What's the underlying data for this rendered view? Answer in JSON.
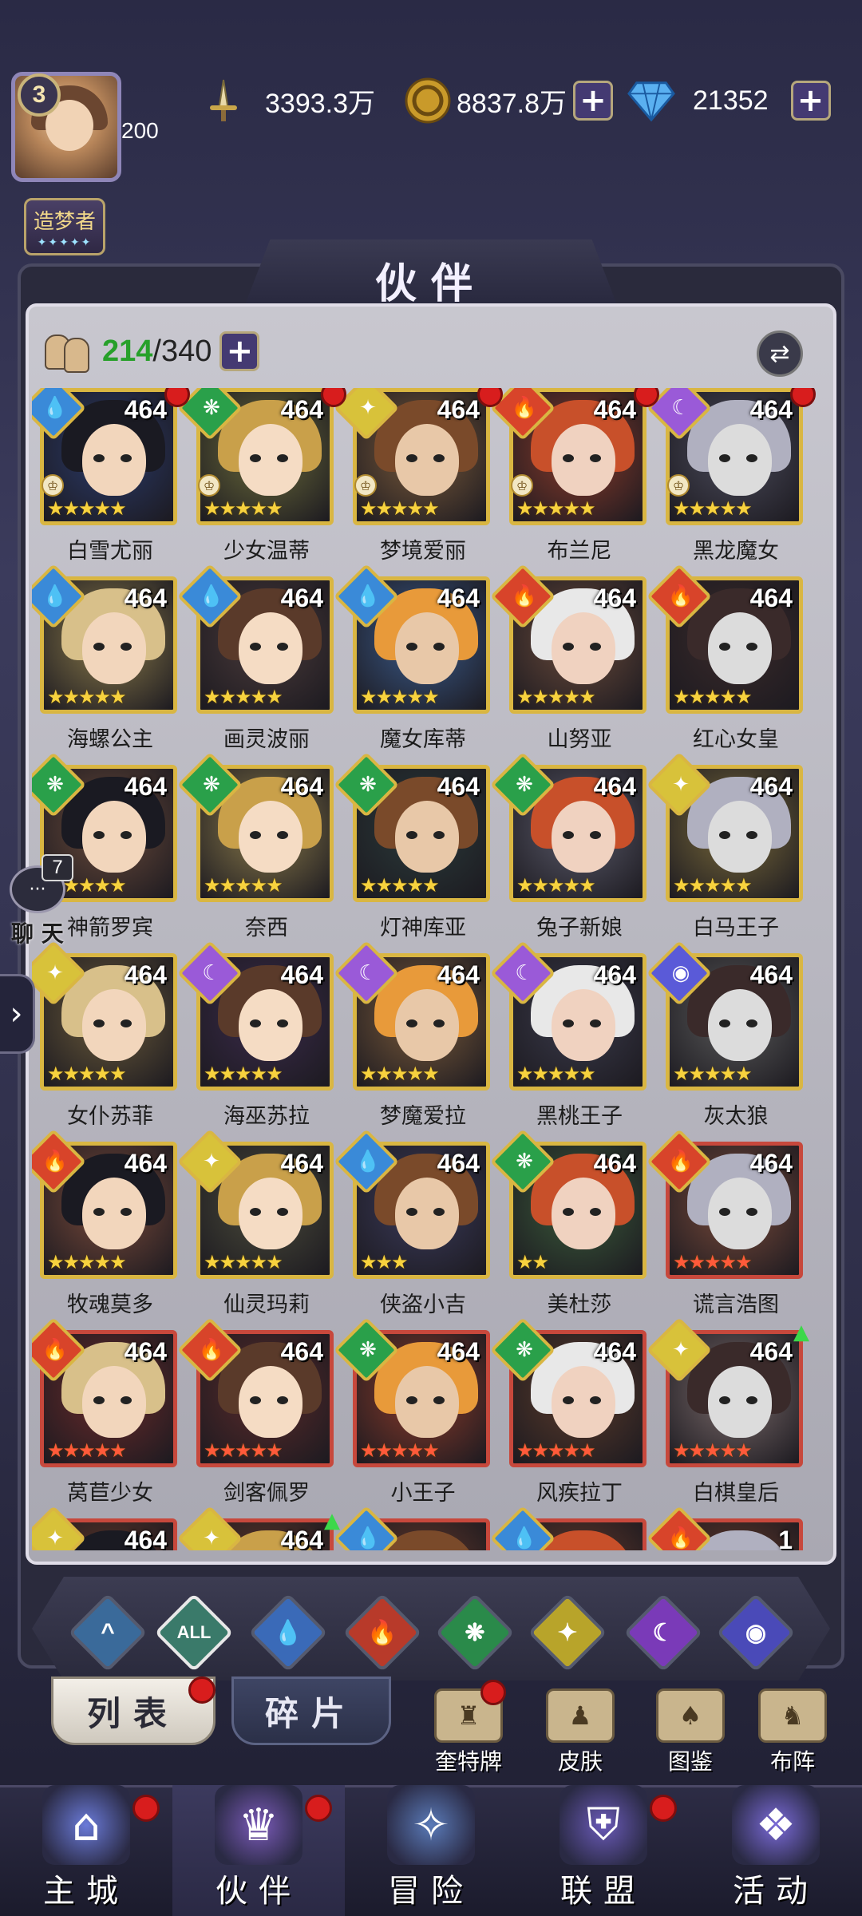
{
  "player": {
    "level": "3",
    "exp": "200",
    "title": "造梦者",
    "title_stars": "✦✦✦✦✦"
  },
  "resources": {
    "power": {
      "value": "3393.3万",
      "icon": "sword-icon"
    },
    "gold": {
      "value": "8837.8万",
      "icon": "coin-icon"
    },
    "diamond": {
      "value": "21352",
      "icon": "diamond-icon"
    },
    "plus": "+"
  },
  "page": {
    "title": "伙伴"
  },
  "roster": {
    "current": "214",
    "separator": "/",
    "max": "340",
    "plus": "+"
  },
  "heroes": [
    {
      "name": "白雪尤丽",
      "level": "464",
      "element": "water",
      "stars": "★★★★★",
      "star_color": "gold",
      "frame": "gold",
      "rank_icon": true,
      "red_dot": true,
      "up_arrow": false,
      "bg": "#2a3a6a"
    },
    {
      "name": "少女温蒂",
      "level": "464",
      "element": "wind",
      "stars": "★★★★★",
      "star_color": "gold",
      "frame": "gold",
      "rank_icon": true,
      "red_dot": true,
      "up_arrow": false,
      "bg": "#6a6a3a"
    },
    {
      "name": "梦境爱丽",
      "level": "464",
      "element": "light",
      "stars": "★★★★★",
      "star_color": "gold",
      "frame": "gold",
      "rank_icon": true,
      "red_dot": true,
      "up_arrow": false,
      "bg": "#7a5a3a"
    },
    {
      "name": "布兰尼",
      "level": "464",
      "element": "fire",
      "stars": "★★★★★",
      "star_color": "gold",
      "frame": "gold",
      "rank_icon": true,
      "red_dot": true,
      "up_arrow": false,
      "bg": "#8a3a2a"
    },
    {
      "name": "黑龙魔女",
      "level": "464",
      "element": "dark",
      "stars": "★★★★★",
      "star_color": "gold",
      "frame": "gold",
      "rank_icon": true,
      "red_dot": true,
      "up_arrow": false,
      "bg": "#4a4a5a"
    },
    {
      "name": "海螺公主",
      "level": "464",
      "element": "water",
      "stars": "★★★★★",
      "star_color": "gold",
      "frame": "gold",
      "rank_icon": false,
      "red_dot": false,
      "up_arrow": false,
      "bg": "#8a7a4a"
    },
    {
      "name": "画灵波丽",
      "level": "464",
      "element": "water",
      "stars": "★★★★★",
      "star_color": "gold",
      "frame": "gold",
      "rank_icon": false,
      "red_dot": false,
      "up_arrow": false,
      "bg": "#4a3a3a"
    },
    {
      "name": "魔女库蒂",
      "level": "464",
      "element": "water",
      "stars": "★★★★★",
      "star_color": "gold",
      "frame": "gold",
      "rank_icon": false,
      "red_dot": false,
      "up_arrow": false,
      "bg": "#3a5a8a"
    },
    {
      "name": "山努亚",
      "level": "464",
      "element": "fire",
      "stars": "★★★★★",
      "star_color": "gold",
      "frame": "gold",
      "rank_icon": false,
      "red_dot": false,
      "up_arrow": false,
      "bg": "#6a4a3a"
    },
    {
      "name": "红心女皇",
      "level": "464",
      "element": "fire",
      "stars": "★★★★★",
      "star_color": "gold",
      "frame": "gold",
      "rank_icon": false,
      "red_dot": false,
      "up_arrow": false,
      "bg": "#3a2a2a"
    },
    {
      "name": "神箭罗宾",
      "level": "464",
      "element": "wind",
      "stars": "★★★★★",
      "star_color": "gold",
      "frame": "gold",
      "rank_icon": false,
      "red_dot": false,
      "up_arrow": false,
      "bg": "#6a4a3a"
    },
    {
      "name": "奈西",
      "level": "464",
      "element": "wind",
      "stars": "★★★★★",
      "star_color": "gold",
      "frame": "gold",
      "rank_icon": false,
      "red_dot": false,
      "up_arrow": false,
      "bg": "#8a7a4a"
    },
    {
      "name": "灯神库亚",
      "level": "464",
      "element": "wind",
      "stars": "★★★★★",
      "star_color": "gold",
      "frame": "gold",
      "rank_icon": false,
      "red_dot": false,
      "up_arrow": false,
      "bg": "#2a3a3a"
    },
    {
      "name": "兔子新娘",
      "level": "464",
      "element": "wind",
      "stars": "★★★★★",
      "star_color": "gold",
      "frame": "gold",
      "rank_icon": false,
      "red_dot": false,
      "up_arrow": false,
      "bg": "#5a5a6a"
    },
    {
      "name": "白马王子",
      "level": "464",
      "element": "light",
      "stars": "★★★★★",
      "star_color": "gold",
      "frame": "gold",
      "rank_icon": false,
      "red_dot": false,
      "up_arrow": false,
      "bg": "#7a6a3a"
    },
    {
      "name": "女仆苏菲",
      "level": "464",
      "element": "light",
      "stars": "★★★★★",
      "star_color": "gold",
      "frame": "gold",
      "rank_icon": false,
      "red_dot": false,
      "up_arrow": false,
      "bg": "#6a5a3a"
    },
    {
      "name": "海巫苏拉",
      "level": "464",
      "element": "dark",
      "stars": "★★★★★",
      "star_color": "gold",
      "frame": "gold",
      "rank_icon": false,
      "red_dot": false,
      "up_arrow": false,
      "bg": "#3a2a4a"
    },
    {
      "name": "梦魔爱拉",
      "level": "464",
      "element": "dark",
      "stars": "★★★★★",
      "star_color": "gold",
      "frame": "gold",
      "rank_icon": false,
      "red_dot": false,
      "up_arrow": false,
      "bg": "#7a5a3a"
    },
    {
      "name": "黑桃王子",
      "level": "464",
      "element": "dark",
      "stars": "★★★★★",
      "star_color": "gold",
      "frame": "gold",
      "rank_icon": false,
      "red_dot": false,
      "up_arrow": false,
      "bg": "#3a3a4a"
    },
    {
      "name": "灰太狼",
      "level": "464",
      "element": "cosmic",
      "stars": "★★★★★",
      "star_color": "gold",
      "frame": "gold",
      "rank_icon": false,
      "red_dot": false,
      "up_arrow": false,
      "bg": "#5a5a5a"
    },
    {
      "name": "牧魂莫多",
      "level": "464",
      "element": "fire",
      "stars": "★★★★★",
      "star_color": "gold",
      "frame": "gold",
      "rank_icon": false,
      "red_dot": false,
      "up_arrow": false,
      "bg": "#7a4a3a"
    },
    {
      "name": "仙灵玛莉",
      "level": "464",
      "element": "light",
      "stars": "★★★★★",
      "star_color": "gold",
      "frame": "gold",
      "rank_icon": false,
      "red_dot": false,
      "up_arrow": false,
      "bg": "#4a4a3a"
    },
    {
      "name": "侠盗小吉",
      "level": "464",
      "element": "water",
      "stars": "★★★",
      "star_color": "gold",
      "frame": "gold",
      "rank_icon": false,
      "red_dot": false,
      "up_arrow": false,
      "bg": "#3a3a5a"
    },
    {
      "name": "美杜莎",
      "level": "464",
      "element": "wind",
      "stars": "★★",
      "star_color": "gold",
      "frame": "gold",
      "rank_icon": false,
      "red_dot": false,
      "up_arrow": false,
      "bg": "#3a5a3a"
    },
    {
      "name": "谎言浩图",
      "level": "464",
      "element": "fire",
      "stars": "★★★★★",
      "star_color": "red",
      "frame": "red",
      "rank_icon": false,
      "red_dot": false,
      "up_arrow": false,
      "bg": "#7a4a3a"
    },
    {
      "name": "莴苣少女",
      "level": "464",
      "element": "fire",
      "stars": "★★★★★",
      "star_color": "red",
      "frame": "red",
      "rank_icon": false,
      "red_dot": false,
      "up_arrow": false,
      "bg": "#6a2a2a"
    },
    {
      "name": "剑客佩罗",
      "level": "464",
      "element": "fire",
      "stars": "★★★★★",
      "star_color": "red",
      "frame": "red",
      "rank_icon": false,
      "red_dot": false,
      "up_arrow": false,
      "bg": "#5a2a2a"
    },
    {
      "name": "小王子",
      "level": "464",
      "element": "wind",
      "stars": "★★★★★",
      "star_color": "red",
      "frame": "red",
      "rank_icon": false,
      "red_dot": false,
      "up_arrow": false,
      "bg": "#8a3a2a"
    },
    {
      "name": "风疾拉丁",
      "level": "464",
      "element": "wind",
      "stars": "★★★★★",
      "star_color": "red",
      "frame": "red",
      "rank_icon": false,
      "red_dot": false,
      "up_arrow": false,
      "bg": "#5a3a2a"
    },
    {
      "name": "白棋皇后",
      "level": "464",
      "element": "light",
      "stars": "★★★★★",
      "star_color": "red",
      "frame": "red",
      "rank_icon": false,
      "red_dot": false,
      "up_arrow": true,
      "bg": "#7a6a6a"
    },
    {
      "name": "",
      "level": "464",
      "element": "light",
      "stars": "",
      "star_color": "gold",
      "frame": "red",
      "rank_icon": false,
      "red_dot": false,
      "up_arrow": false,
      "bg": "#6a3a2a"
    },
    {
      "name": "",
      "level": "464",
      "element": "light",
      "stars": "",
      "star_color": "gold",
      "frame": "red",
      "rank_icon": false,
      "red_dot": false,
      "up_arrow": true,
      "bg": "#6a3a2a"
    },
    {
      "name": "",
      "level": "",
      "element": "water",
      "stars": "",
      "star_color": "gold",
      "frame": "red",
      "rank_icon": false,
      "red_dot": false,
      "up_arrow": false,
      "bg": "#6a3a2a"
    },
    {
      "name": "",
      "level": "",
      "element": "water",
      "stars": "",
      "star_color": "gold",
      "frame": "red",
      "rank_icon": false,
      "red_dot": false,
      "up_arrow": false,
      "bg": "#6a3a2a"
    },
    {
      "name": "",
      "level": "1",
      "element": "fire",
      "stars": "",
      "star_color": "gold",
      "frame": "red",
      "rank_icon": false,
      "red_dot": false,
      "up_arrow": false,
      "bg": "#6a3a2a"
    }
  ],
  "element_colors": {
    "water": "#3a8ad8",
    "wind": "#2aa04a",
    "light": "#d8c23a",
    "fire": "#d8442a",
    "dark": "#9a5ad8",
    "cosmic": "#5a5ad8",
    "all": "#5ac8a8"
  },
  "element_glyphs": {
    "water": "💧",
    "wind": "❋",
    "light": "✦",
    "fire": "🔥",
    "dark": "☾",
    "cosmic": "◉"
  },
  "filters": [
    {
      "key": "arrow",
      "label": "^",
      "icon": "chevron-up-icon",
      "color": "#3a6a9a"
    },
    {
      "key": "all",
      "label": "ALL",
      "icon": "all-icon",
      "color": "#3a7a6a"
    },
    {
      "key": "water",
      "label": "💧",
      "icon": "water-icon",
      "color": "#3a6ab8"
    },
    {
      "key": "fire",
      "label": "🔥",
      "icon": "fire-icon",
      "color": "#b83a2a"
    },
    {
      "key": "wind",
      "label": "❋",
      "icon": "wind-icon",
      "color": "#2a8a4a"
    },
    {
      "key": "light",
      "label": "✦",
      "icon": "light-icon",
      "color": "#b8a42a"
    },
    {
      "key": "dark",
      "label": "☾",
      "icon": "dark-icon",
      "color": "#7a3ab8"
    },
    {
      "key": "cosmic",
      "label": "◉",
      "icon": "cosmic-icon",
      "color": "#4a4ab8"
    }
  ],
  "tabs": {
    "list": "列表",
    "fragments": "碎片"
  },
  "side_buttons": [
    {
      "label": "奎特牌",
      "icon": "card-badge-icon",
      "glyph": "♜",
      "red_dot": true
    },
    {
      "label": "皮肤",
      "icon": "outfit-icon",
      "glyph": "♟",
      "red_dot": false
    },
    {
      "label": "图鉴",
      "icon": "codex-icon",
      "glyph": "♠",
      "red_dot": false
    },
    {
      "label": "布阵",
      "icon": "formation-icon",
      "glyph": "♞",
      "red_dot": false
    }
  ],
  "nav": [
    {
      "label": "主城",
      "icon": "castle-icon",
      "glyph": "⌂",
      "red_dot": true,
      "active": false
    },
    {
      "label": "伙伴",
      "icon": "hat-icon",
      "glyph": "♛",
      "red_dot": true,
      "active": true
    },
    {
      "label": "冒险",
      "icon": "compass-icon",
      "glyph": "✧",
      "red_dot": false,
      "active": false
    },
    {
      "label": "联盟",
      "icon": "shield-icon",
      "glyph": "⛨",
      "red_dot": true,
      "active": false
    },
    {
      "label": "活动",
      "icon": "cards-icon",
      "glyph": "❖",
      "red_dot": false,
      "active": false
    }
  ],
  "chat": {
    "count": "7",
    "label": "聊 天",
    "glyph": "···"
  },
  "expander_glyph": "›",
  "swap_glyph": "⇄"
}
